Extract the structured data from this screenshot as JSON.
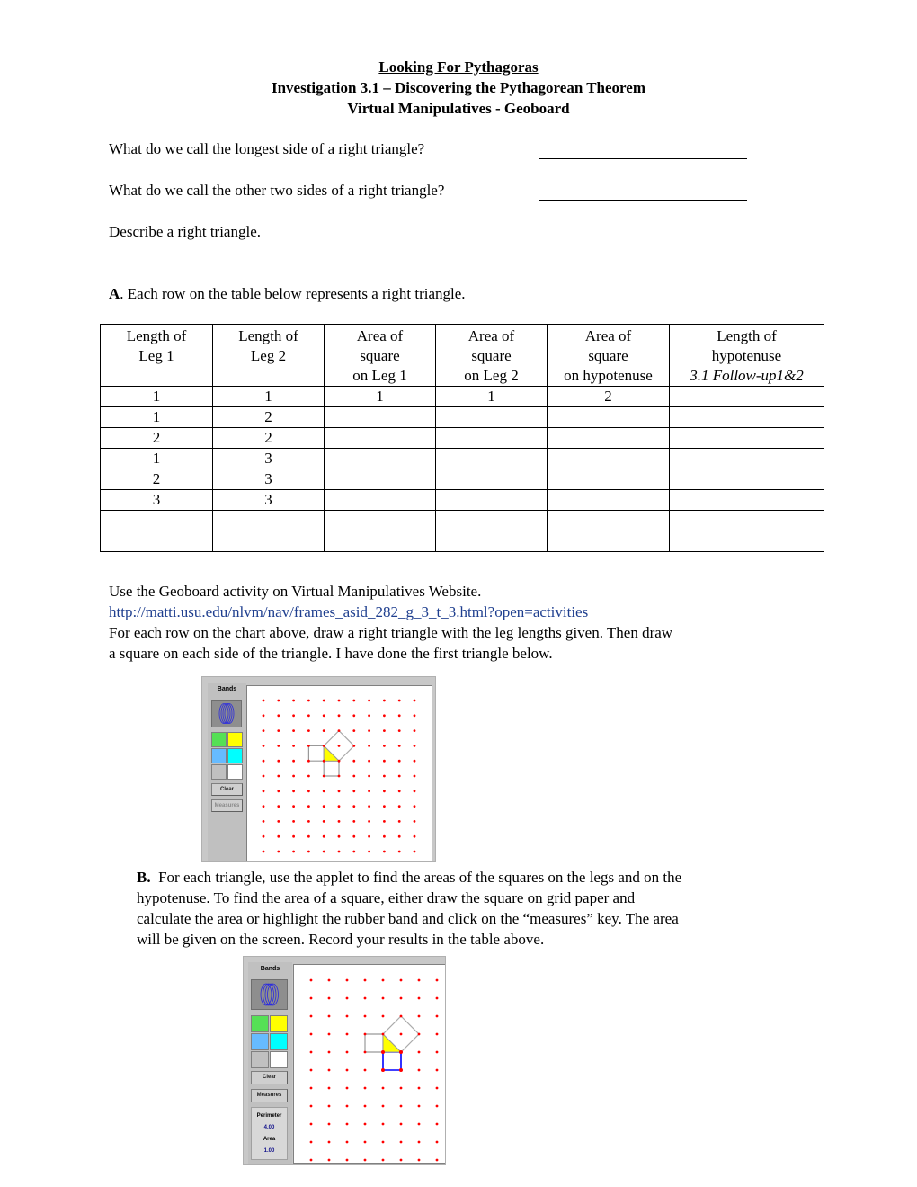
{
  "header": {
    "title": "Looking For Pythagoras",
    "subtitle": "Investigation 3.1 – Discovering the Pythagorean Theorem",
    "subtitle2": "Virtual Manipulatives - Geoboard"
  },
  "questions": [
    "What do we call the longest side of a right triangle?",
    "What do we call the other two sides of a right triangle?",
    "Describe a right triangle."
  ],
  "section_a": {
    "label": "A",
    "text": ". Each row on the table below represents a right triangle."
  },
  "table": {
    "headers": [
      [
        "Length of",
        "Leg 1",
        ""
      ],
      [
        "Length of",
        "Leg 2",
        ""
      ],
      [
        "Area of",
        "square",
        "on Leg 1"
      ],
      [
        "Area of",
        "square",
        "on Leg 2"
      ],
      [
        "Area of",
        "square",
        "on hypotenuse"
      ],
      [
        "Length of",
        "hypotenuse",
        "3.1 Follow-up1&2"
      ]
    ],
    "rows": [
      [
        "1",
        "1",
        "1",
        "1",
        "2",
        ""
      ],
      [
        "1",
        "2",
        "",
        "",
        "",
        ""
      ],
      [
        "2",
        "2",
        "",
        "",
        "",
        ""
      ],
      [
        "1",
        "3",
        "",
        "",
        "",
        ""
      ],
      [
        "2",
        "3",
        "",
        "",
        "",
        ""
      ],
      [
        "3",
        "3",
        "",
        "",
        "",
        ""
      ],
      [
        "",
        "",
        "",
        "",
        "",
        ""
      ],
      [
        "",
        "",
        "",
        "",
        "",
        ""
      ]
    ]
  },
  "instructions": {
    "line1": "Use the Geoboard activity on Virtual Manipulatives Website.",
    "link": "http://matti.usu.edu/nlvm/nav/frames_asid_282_g_3_t_3.html?open=activities",
    "line2": "For each row on the chart above, draw a right triangle with the leg lengths given.  Then draw",
    "line3": "a square on each side of the triangle.  I have done the first triangle below."
  },
  "section_b": {
    "label": "B.",
    "line1": "  For each triangle, use the applet to find the areas of the squares on the legs and on the",
    "line2": "hypotenuse.  To find the area of a square, either draw the square on grid paper and",
    "line3": "calculate the area or highlight the rubber band and click on the “measures” key. The area",
    "line4": "will be given on the screen.  Record your results in the table above."
  },
  "geoboard1": {
    "bands_label": "Bands",
    "clear_label": "Clear",
    "measures_label": "Measures",
    "swatch_colors": [
      "#55e055",
      "#ffff00",
      "#66bbff",
      "#00ffff",
      "#c0c0c0",
      "#ffffff"
    ],
    "dot_color": "#ff0000",
    "triangle_fill": "#ffff00"
  },
  "geoboard2": {
    "bands_label": "Bands",
    "clear_label": "Clear",
    "measures_label": "Measures",
    "perimeter_label": "Perimeter",
    "perimeter_value": "4.00",
    "area_label": "Area",
    "area_value": "1.00",
    "swatch_colors": [
      "#55e055",
      "#ffff00",
      "#66bbff",
      "#00ffff",
      "#c0c0c0",
      "#ffffff"
    ],
    "dot_color": "#ff0000",
    "triangle_fill": "#ffff00",
    "selected_band_color": "#0000ff"
  }
}
